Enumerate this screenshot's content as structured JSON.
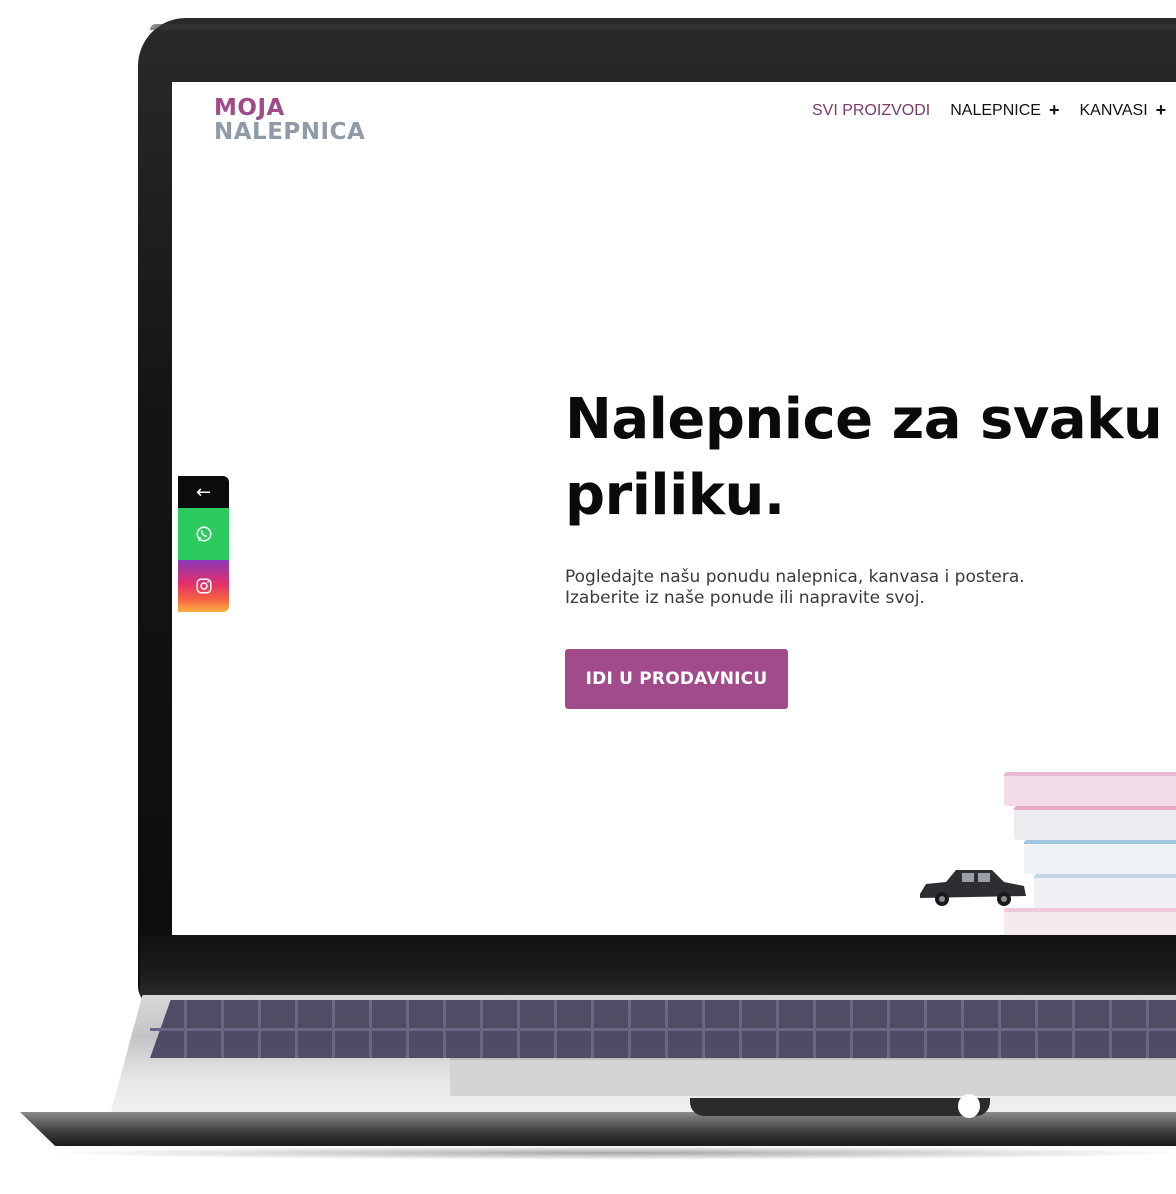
{
  "site": {
    "logo_line1": "MOJA",
    "logo_line2": "NALEPNICA",
    "brand_color": "#a24b8b",
    "logo_secondary_color": "#8f9ba6"
  },
  "nav": {
    "items": [
      {
        "label": "SVI PROIZVODI",
        "has_submenu": false
      },
      {
        "label": "NALEPNICE",
        "has_submenu": true
      },
      {
        "label": "KANVASI",
        "has_submenu": true
      }
    ],
    "submenu_icon": "plus-icon"
  },
  "hero": {
    "title": "Nalepnice za svaku priliku.",
    "subtitle_line1": "Pogledajte našu ponudu nalepnica, kanvasa i postera.",
    "subtitle_line2": "Izaberite iz naše ponude ili napravite svoj.",
    "cta_label": "IDI U PRODAVNICU"
  },
  "social_bar": {
    "toggle_icon": "arrow-left-icon",
    "toggle_glyph": "←",
    "buttons": [
      {
        "icon": "whatsapp-icon",
        "color": "#2bcb5f"
      },
      {
        "icon": "instagram-icon",
        "color": "#e1306c"
      }
    ]
  }
}
